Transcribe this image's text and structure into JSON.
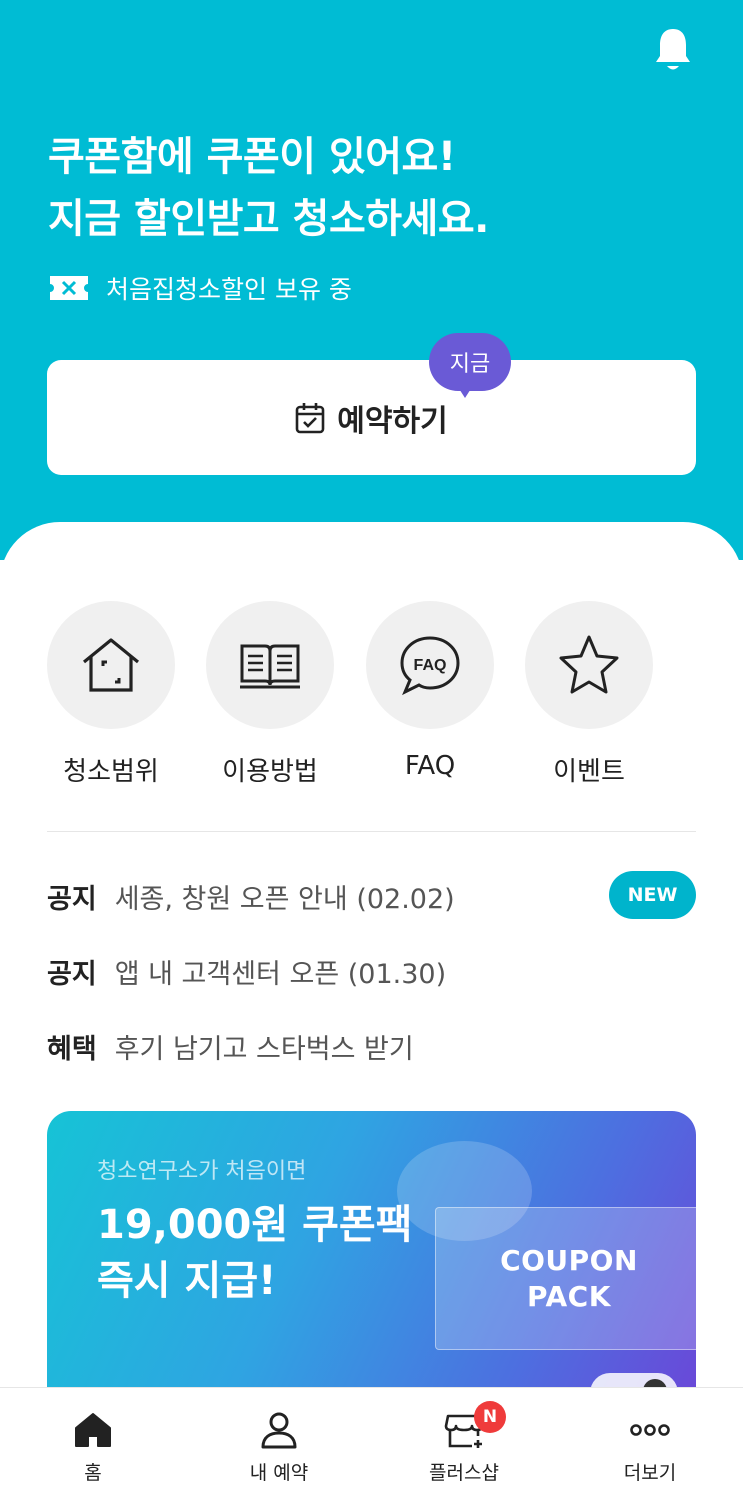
{
  "header": {
    "title_line1": "쿠폰함에 쿠폰이 있어요!",
    "title_line2": "지금 할인받고 청소하세요.",
    "coupon_status": "처음집청소할인 보유 중",
    "notification_icon": "bell-icon",
    "coupon_icon": "coupon-ticket-icon"
  },
  "reserve": {
    "label": "예약하기",
    "badge": "지금",
    "icon": "calendar-check-icon"
  },
  "menu": [
    {
      "label": "청소범위",
      "icon": "house-icon"
    },
    {
      "label": "이용방법",
      "icon": "book-icon"
    },
    {
      "label": "FAQ",
      "icon": "faq-bubble-icon"
    },
    {
      "label": "이벤트",
      "icon": "star-icon"
    }
  ],
  "notices": [
    {
      "tag": "공지",
      "text": "세종, 창원 오픈 안내 (02.02)",
      "badge": "NEW"
    },
    {
      "tag": "공지",
      "text": "앱 내 고객센터 오픈 (01.30)"
    },
    {
      "tag": "혜택",
      "text": "후기 남기고 스타벅스 받기"
    }
  ],
  "banner": {
    "subtitle": "청소연구소가 처음이면",
    "title_line1": "19,000원 쿠폰팩",
    "title_line2": "즉시 지급!",
    "card_line1": "COUPON",
    "card_line2": "PACK"
  },
  "tabs": [
    {
      "label": "홈",
      "icon": "home-icon"
    },
    {
      "label": "내 예약",
      "icon": "person-icon"
    },
    {
      "label": "플러스샵",
      "icon": "shop-icon",
      "badge": "N"
    },
    {
      "label": "더보기",
      "icon": "more-dots-icon"
    }
  ],
  "colors": {
    "primary": "#00bcd4",
    "badge_purple": "#6a5ad6",
    "new_badge": "#00b4cc",
    "alert_red": "#ef3b3b"
  }
}
